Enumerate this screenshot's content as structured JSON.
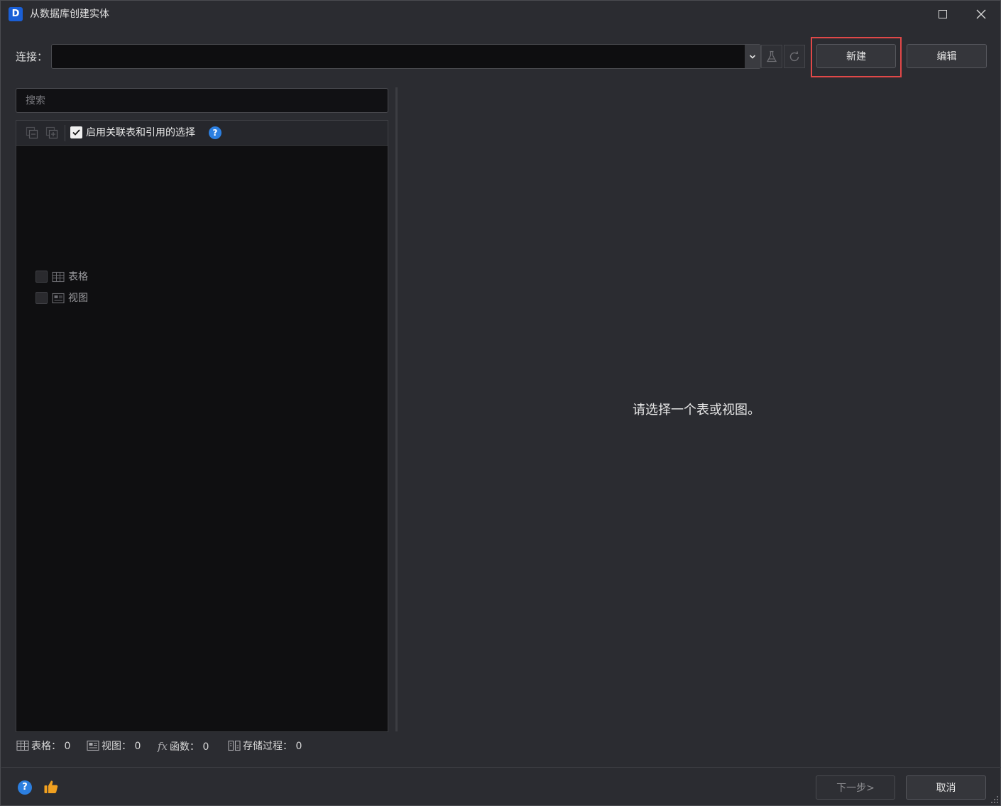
{
  "window": {
    "title": "从数据库创建实体",
    "logo_letter": "D"
  },
  "connection": {
    "label": "连接：",
    "value": "",
    "new_label": "新建",
    "edit_label": "编辑"
  },
  "search": {
    "placeholder": "搜索"
  },
  "tree": {
    "related_option_label": "启用关联表和引用的选择",
    "related_option_checked": true,
    "help_symbol": "?",
    "items": [
      {
        "label": "表格",
        "icon": "table-icon",
        "checked": false
      },
      {
        "label": "视图",
        "icon": "view-icon",
        "checked": false
      }
    ]
  },
  "detail": {
    "message": "请选择一个表或视图。"
  },
  "status": {
    "tables_label": "表格：",
    "tables_count": "0",
    "views_label": "视图：",
    "views_count": "0",
    "funcs_symbol": "fx",
    "funcs_label": "函数：",
    "funcs_count": "0",
    "procs_label": "存储过程：",
    "procs_count": "0"
  },
  "footer": {
    "help_symbol": "?",
    "next_label": "下一步>",
    "cancel_label": "取消"
  },
  "colors": {
    "accent_blue": "#2c7fe0",
    "highlight_red": "#e04848",
    "like_orange": "#f0a020"
  }
}
